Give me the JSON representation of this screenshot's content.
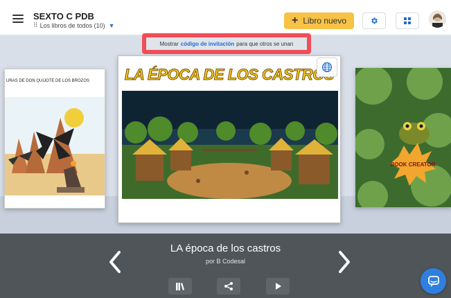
{
  "header": {
    "library_title": "SEXTO C PDB",
    "library_subtitle": "Los libros de todos (10)",
    "new_book_label": "Libro nuevo",
    "accent_color": "#f7c245"
  },
  "invite_banner": {
    "prefix": "Mostrar",
    "link": "código de invitación",
    "suffix": "para que otros se unan"
  },
  "books": {
    "left_caption": "URAS DE DON QUIJOTE DE LOS BROZOS",
    "center_title": "LA ÉPOCA DE LOS CASTROS",
    "right_cover_text": "BOOK CREATOR"
  },
  "current_book": {
    "title": "LA época de los castros",
    "author": "por B Codesal"
  },
  "icons": {
    "menu": "hamburger-icon",
    "subtitle": "people-icon",
    "dropdown": "chevron-down-icon",
    "settings": "gear-icon",
    "grid": "grid-icon",
    "globe": "globe-icon",
    "prev": "chevron-left-icon",
    "next": "chevron-right-icon",
    "library": "books-icon",
    "share": "share-icon",
    "play": "play-icon",
    "chat": "chat-icon"
  }
}
